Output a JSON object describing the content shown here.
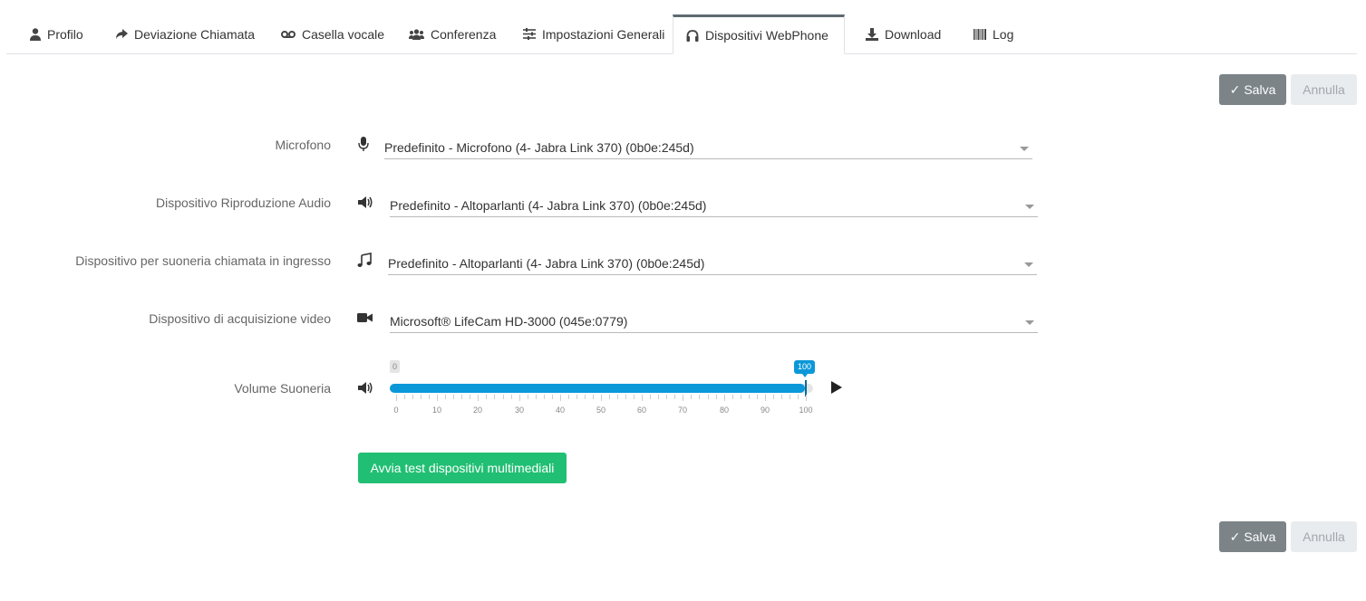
{
  "tabs": [
    {
      "label": "Profilo",
      "icon": "user-icon",
      "active": false
    },
    {
      "label": "Deviazione Chiamata",
      "icon": "share-icon",
      "active": false
    },
    {
      "label": "Casella vocale",
      "icon": "voicemail-icon",
      "active": false
    },
    {
      "label": "Conferenza",
      "icon": "users-icon",
      "active": false
    },
    {
      "label": "Impostazioni Generali",
      "icon": "sliders-icon",
      "active": false
    },
    {
      "label": "Dispositivi WebPhone",
      "icon": "headphones-icon",
      "active": true
    },
    {
      "label": "Download",
      "icon": "download-icon",
      "active": false
    },
    {
      "label": "Log",
      "icon": "barcode-icon",
      "active": false
    }
  ],
  "actions": {
    "save_label": "Salva",
    "cancel_label": "Annulla"
  },
  "form": {
    "microphone": {
      "label": "Microfono",
      "icon": "microphone-icon",
      "value": "Predefinito - Microfono (4- Jabra Link 370) (0b0e:245d)"
    },
    "playback": {
      "label": "Dispositivo Riproduzione Audio",
      "icon": "volume-icon",
      "value": "Predefinito - Altoparlanti (4- Jabra Link 370) (0b0e:245d)"
    },
    "ringer": {
      "label": "Dispositivo per suoneria chiamata in ingresso",
      "icon": "music-icon",
      "value": "Predefinito - Altoparlanti (4- Jabra Link 370) (0b0e:245d)"
    },
    "video": {
      "label": "Dispositivo di acquisizione video",
      "icon": "video-camera-icon",
      "value": "Microsoft® LifeCam HD-3000 (045e:0779)"
    },
    "volume": {
      "label": "Volume Suoneria",
      "icon": "volume-icon",
      "min": "0",
      "max": "100",
      "value": 100,
      "tick_labels": [
        "0",
        "10",
        "20",
        "30",
        "40",
        "50",
        "60",
        "70",
        "80",
        "90",
        "100"
      ]
    }
  },
  "test_button_label": "Avvia test dispositivi multimediali",
  "colors": {
    "accent": "#0b98d8",
    "success": "#21bf73",
    "save": "#7c8488"
  }
}
